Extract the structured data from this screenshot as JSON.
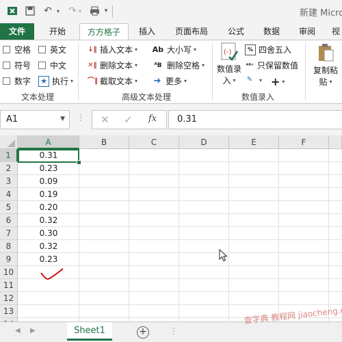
{
  "window": {
    "title": "新建 Micro"
  },
  "ribbon": {
    "tabs": [
      "文件",
      "开始",
      "方方格子",
      "插入",
      "页面布局",
      "公式",
      "数据",
      "审阅",
      "视"
    ],
    "active_tab": "方方格子",
    "text_group": {
      "options": [
        "空格",
        "英文",
        "符号",
        "中文",
        "数字"
      ],
      "execute_label": "执行",
      "label": "文本处理"
    },
    "advanced_group": {
      "insert_text": "插入文本",
      "delete_text": "删除文本",
      "extract_text": "截取文本",
      "case": "大小写",
      "delete_space": "删除空格",
      "more": "更多",
      "label": "高级文本处理"
    },
    "number_group": {
      "entry_label_1": "数值录",
      "entry_label_2": "入",
      "round": "四舍五入",
      "keep_value": "只保留数值",
      "label": "数值录入"
    },
    "paste_group": {
      "label_1": "复制粘",
      "label_2": "贴"
    }
  },
  "formula_bar": {
    "name_box": "A1",
    "fx": "fx",
    "value": "0.31"
  },
  "grid": {
    "columns": [
      "A",
      "B",
      "C",
      "D",
      "E",
      "F"
    ],
    "rows": [
      "1",
      "2",
      "3",
      "4",
      "5",
      "6",
      "7",
      "8",
      "9",
      "10",
      "11",
      "12",
      "13",
      "14"
    ],
    "values": [
      "0.31",
      "0.23",
      "0.09",
      "0.19",
      "0.20",
      "0.32",
      "0.30",
      "0.32",
      "0.23"
    ],
    "selected_cell": "A1"
  },
  "sheets": {
    "tabs": [
      "Sheet1"
    ],
    "active": "Sheet1"
  },
  "watermark": "查字典 教程网 jiaocheng.chazidian.com",
  "colors": {
    "accent": "#217346",
    "checkmark": "#cc0000"
  }
}
